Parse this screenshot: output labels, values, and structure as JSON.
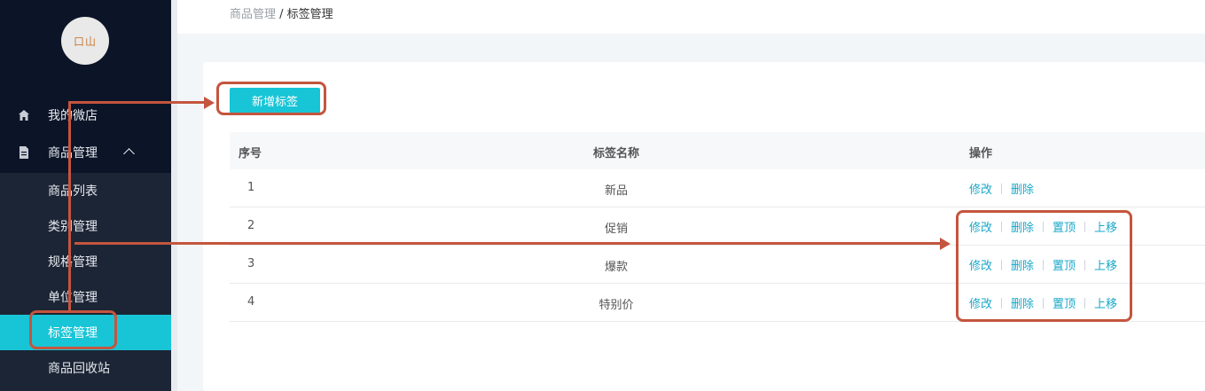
{
  "sidebar": {
    "logo_text": "口山",
    "items": [
      {
        "label": "我的微店"
      },
      {
        "label": "商品管理"
      }
    ],
    "submenu": [
      {
        "label": "商品列表"
      },
      {
        "label": "类别管理"
      },
      {
        "label": "规格管理"
      },
      {
        "label": "单位管理"
      },
      {
        "label": "标签管理"
      },
      {
        "label": "商品回收站"
      }
    ]
  },
  "breadcrumb": {
    "parent": "商品管理",
    "separator": " / ",
    "current": "标签管理"
  },
  "toolbar": {
    "add_label": "新增标签"
  },
  "table": {
    "headers": [
      "序号",
      "标签名称",
      "操作"
    ],
    "rows": [
      {
        "index": "1",
        "name": "新品",
        "actions": [
          "修改",
          "删除"
        ]
      },
      {
        "index": "2",
        "name": "促销",
        "actions": [
          "修改",
          "删除",
          "置顶",
          "上移"
        ]
      },
      {
        "index": "3",
        "name": "爆款",
        "actions": [
          "修改",
          "删除",
          "置顶",
          "上移"
        ]
      },
      {
        "index": "4",
        "name": "特别价",
        "actions": [
          "修改",
          "删除",
          "置顶",
          "上移"
        ]
      }
    ]
  },
  "colors": {
    "accent": "#18c5d6",
    "link": "#1aa7c9",
    "sidebar_bg": "#0c1527",
    "annotation": "#c4553e"
  },
  "icons": {
    "home": "home-icon",
    "goods": "document-icon",
    "expand": "chevron-up-icon"
  }
}
